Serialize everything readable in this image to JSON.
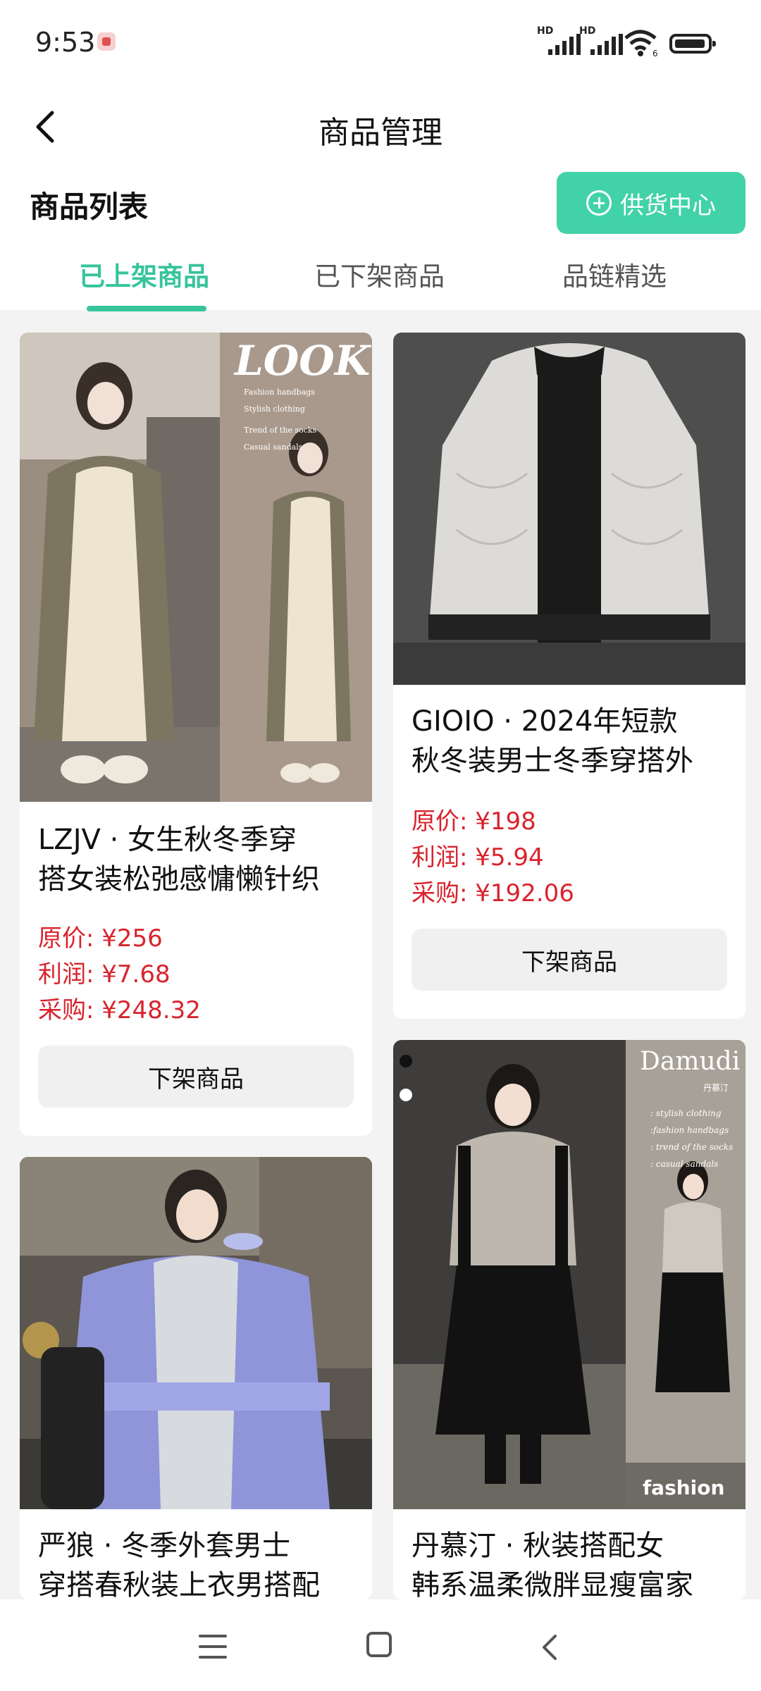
{
  "status_bar": {
    "time": "9:53",
    "sim1": "HD",
    "sim2": "HD",
    "wifi_badge": "6"
  },
  "header": {
    "title": "商品管理",
    "section_title": "商品列表",
    "supply_button": "供货中心",
    "tabs": [
      {
        "label": "已上架商品",
        "active": true
      },
      {
        "label": "已下架商品",
        "active": false
      },
      {
        "label": "品链精选",
        "active": false
      }
    ]
  },
  "products": [
    {
      "title": "LZJV · 女生秋冬季穿搭女装松弛感慵懒针织",
      "title_line1": "LZJV · 女生秋冬季穿",
      "title_line2": "搭女装松弛感慵懒针织",
      "original_price": "原价: ¥256",
      "profit": "利润: ¥7.68",
      "purchase": "采购: ¥248.32",
      "action": "下架商品",
      "image_overlay": {
        "brand": "LOOK",
        "lines": [
          "Fashion handbags",
          "Stylish clothing",
          "Trend of the socks",
          "Casual sandals"
        ]
      }
    },
    {
      "title": "GIOIO · 2024年短款秋冬装男士冬季穿搭外",
      "title_line1": "GIOIO · 2024年短款",
      "title_line2": "秋冬装男士冬季穿搭外",
      "original_price": "原价: ¥198",
      "profit": "利润: ¥5.94",
      "purchase": "采购: ¥192.06",
      "action": "下架商品"
    },
    {
      "title": "严狼 · 冬季外套男士穿搭春秋装上衣男搭配",
      "title_line1": "严狼 · 冬季外套男士",
      "title_line2": "穿搭春秋装上衣男搭配"
    },
    {
      "title": "丹慕汀 · 秋装搭配女韩系温柔微胖显瘦富家",
      "title_line1": "丹慕汀 · 秋装搭配女",
      "title_line2": "韩系温柔微胖显瘦富家",
      "image_overlay": {
        "brand": "Damudi",
        "brand_cn": "丹慕汀",
        "lines": [
          ": stylish clothing",
          ":fashion handbags",
          ": trend of the socks",
          ": casual sandals"
        ],
        "tag": "fashion"
      }
    }
  ],
  "colors": {
    "accent": "#37c49b",
    "button": "#42d2a8",
    "price": "#d9232d",
    "background": "#f3f3f3"
  },
  "nav_icons": [
    "menu-icon",
    "home-icon",
    "back-icon"
  ]
}
